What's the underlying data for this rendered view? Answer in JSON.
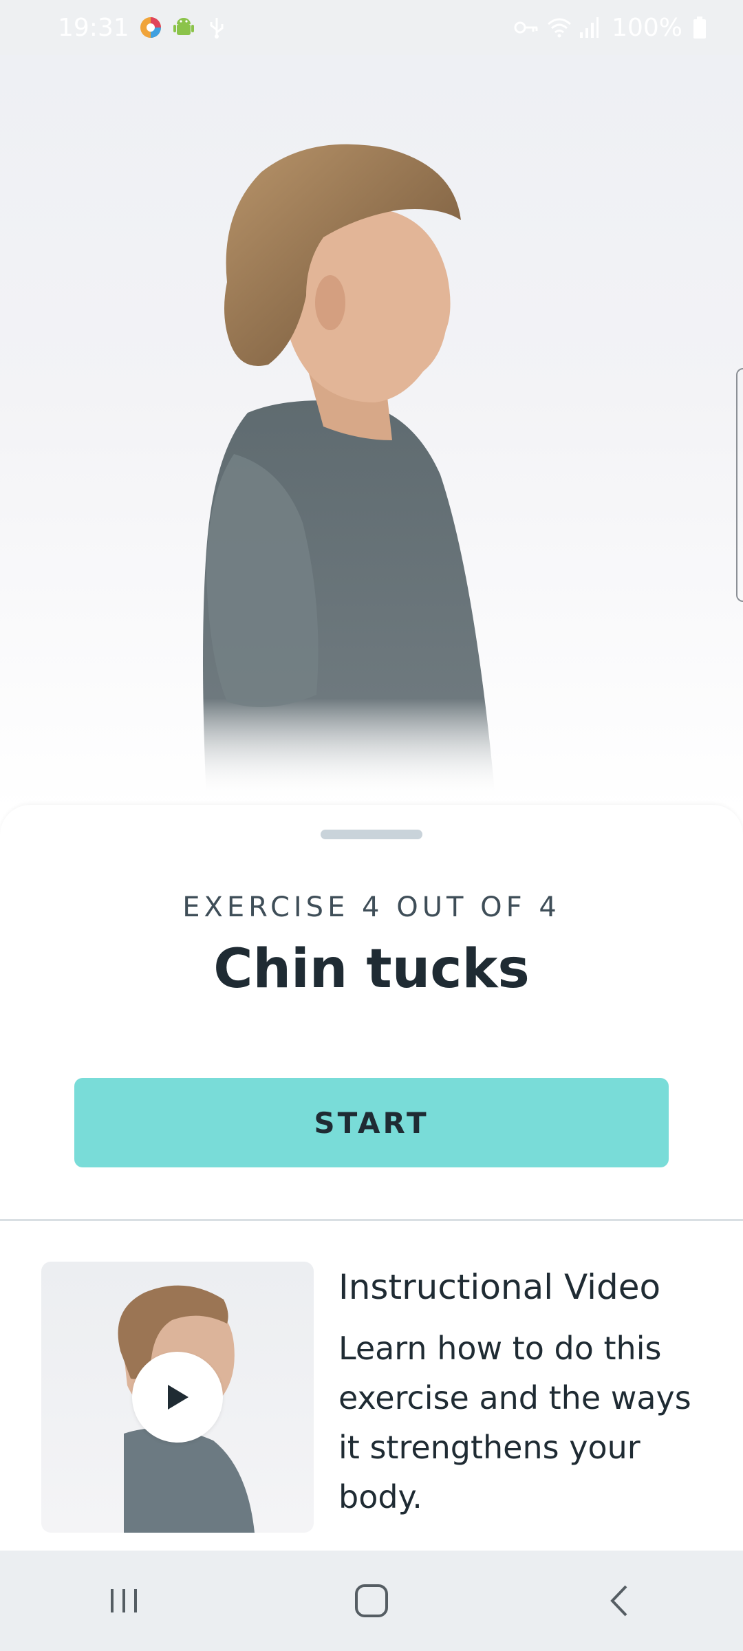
{
  "status_bar": {
    "time": "19:31",
    "battery": "100%",
    "icons_left": [
      "assistant-app-icon",
      "android-icon",
      "usb-icon"
    ],
    "icons_right": [
      "vpn-key-icon",
      "wifi-icon",
      "signal-icon",
      "battery-icon"
    ]
  },
  "exercise": {
    "progress": "EXERCISE 4 OUT OF 4",
    "title": "Chin tucks",
    "start_label": "START"
  },
  "video": {
    "heading": "Instructional Video",
    "description": "Learn how to do this exercise and the ways it strengthens your body."
  },
  "nav": {
    "icons": [
      "recent-apps-icon",
      "home-icon",
      "back-icon"
    ]
  },
  "colors": {
    "accent": "#79dcd8",
    "text_dark": "#1f2b33",
    "text_muted": "#3f4e58"
  }
}
